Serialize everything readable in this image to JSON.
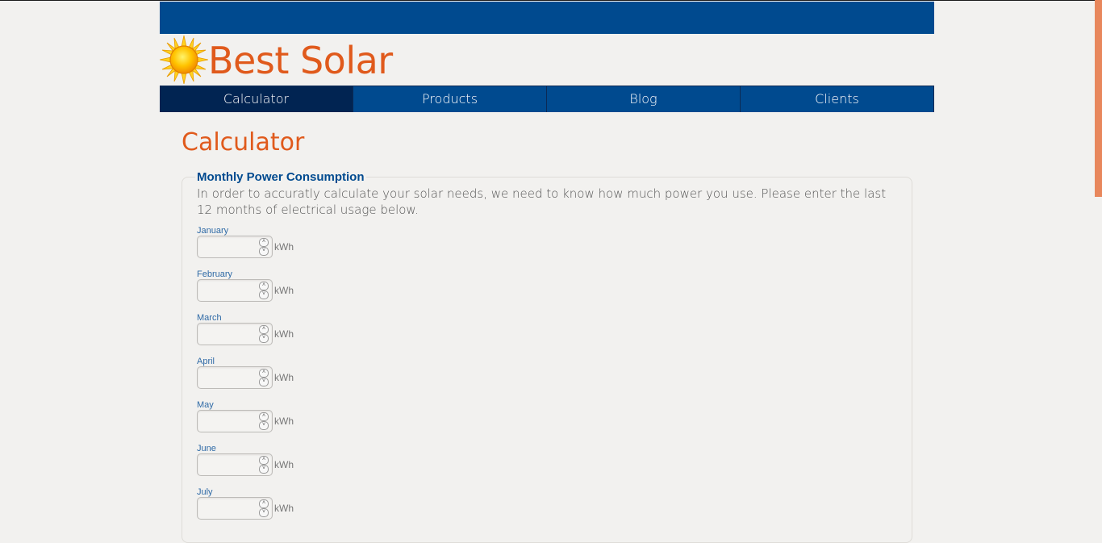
{
  "site": {
    "title": "Best Solar"
  },
  "nav": {
    "items": [
      {
        "label": "Calculator",
        "active": true
      },
      {
        "label": "Products"
      },
      {
        "label": "Blog"
      },
      {
        "label": "Clients"
      }
    ]
  },
  "main": {
    "title": "Calculator",
    "fieldset": {
      "legend": "Monthly Power Consumption",
      "intro": "In order to accuratly calculate your solar needs, we need to know how much power you use. Please enter the last 12 months of electrical usage below.",
      "unit": "kWh",
      "months": [
        "January",
        "February",
        "March",
        "April",
        "May",
        "June",
        "July"
      ]
    }
  },
  "colors": {
    "brand_blue": "#004a8f",
    "accent_orange": "#e05a1c",
    "active_nav": "#012452"
  },
  "icons": {
    "logo": "sun-icon",
    "spinner_up": "chevron-up-icon",
    "spinner_down": "chevron-down-icon"
  }
}
